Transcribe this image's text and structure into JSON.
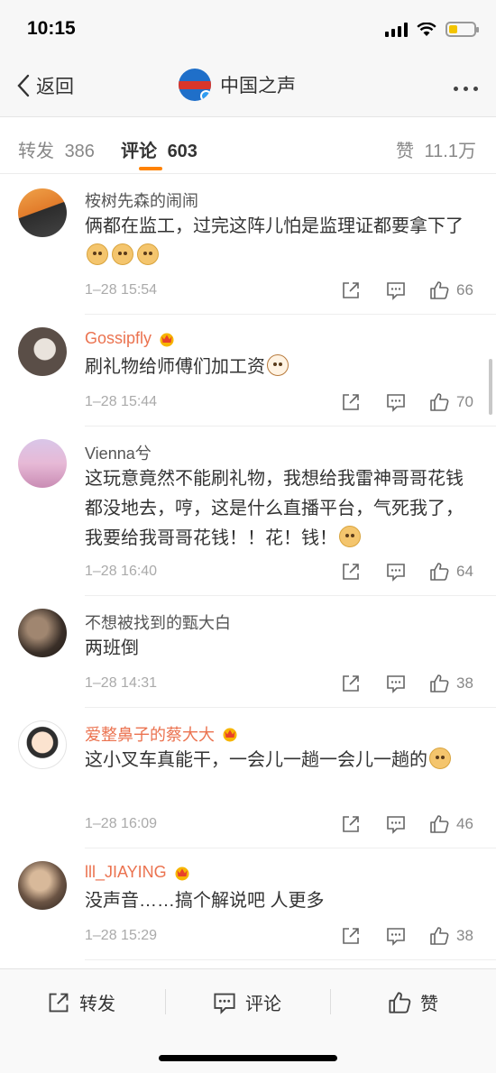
{
  "status_bar": {
    "time": "10:15"
  },
  "nav": {
    "back_label": "返回",
    "title": "中国之声"
  },
  "tabs": {
    "repost_label": "转发",
    "repost_count": "386",
    "comment_label": "评论",
    "comment_count": "603",
    "like_label": "赞",
    "like_count": "11.1万"
  },
  "comments": [
    {
      "name": "桉树先森的闹闹",
      "text": "俩都在监工，过完这阵儿怕是监理证都要拿下了",
      "time": "1–28 15:54",
      "likes": "66"
    },
    {
      "name": "Gossipfly",
      "text": "刷礼物给师傅们加工资",
      "time": "1–28 15:44",
      "likes": "70"
    },
    {
      "name": "Vienna兮",
      "text": "这玩意竟然不能刷礼物，我想给我雷神哥哥花钱都没地去，哼，这是什么直播平台，气死我了，我要给我哥哥花钱！！花！钱！",
      "time": "1–28 16:40",
      "likes": "64"
    },
    {
      "name": "不想被找到的甄大白",
      "text": "两班倒",
      "time": "1–28 14:31",
      "likes": "38"
    },
    {
      "name": "爱整鼻子的蔡大大",
      "text": "这小叉车真能干，一会儿一趟一会儿一趟的",
      "time": "1–28 16:09",
      "likes": "46"
    },
    {
      "name": "lll_JIAYING",
      "text": "没声音……搞个解说吧  人更多",
      "time": "1–28 15:29",
      "likes": "38"
    }
  ],
  "bottom_bar": {
    "repost": "转发",
    "comment": "评论",
    "like": "赞"
  },
  "colors": {
    "accent": "#ff8200",
    "vip_name": "#eb7350",
    "meta": "#aaaaaa"
  }
}
